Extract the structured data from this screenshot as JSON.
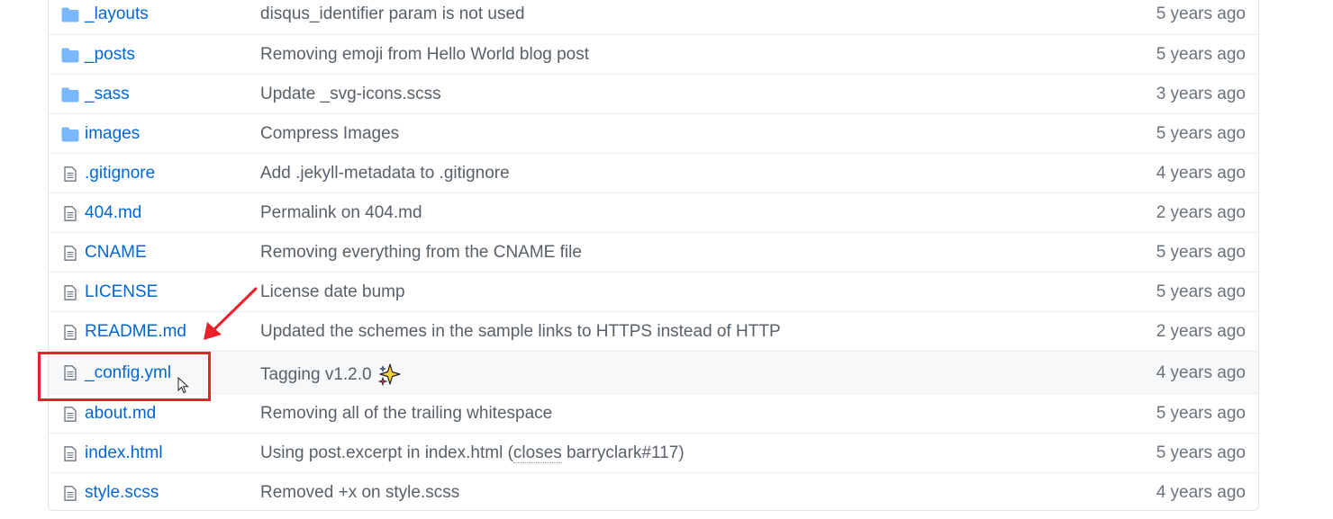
{
  "accent": "#0366d6",
  "annotation_color": "#e8212b",
  "files": [
    {
      "type": "folder",
      "icon": "folder-icon",
      "name": "_layouts",
      "message": "disqus_identifier param is not used",
      "age": "5 years ago"
    },
    {
      "type": "folder",
      "icon": "folder-icon",
      "name": "_posts",
      "message": "Removing emoji from Hello World blog post",
      "age": "5 years ago"
    },
    {
      "type": "folder",
      "icon": "folder-icon",
      "name": "_sass",
      "message": "Update _svg-icons.scss",
      "age": "3 years ago"
    },
    {
      "type": "folder",
      "icon": "folder-icon",
      "name": "images",
      "message": "Compress Images",
      "age": "5 years ago"
    },
    {
      "type": "file",
      "icon": "file-icon",
      "name": ".gitignore",
      "message": "Add .jekyll-metadata to .gitignore",
      "age": "4 years ago"
    },
    {
      "type": "file",
      "icon": "file-icon",
      "name": "404.md",
      "message": "Permalink on 404.md",
      "age": "2 years ago"
    },
    {
      "type": "file",
      "icon": "file-icon",
      "name": "CNAME",
      "message": "Removing everything from the CNAME file",
      "age": "5 years ago"
    },
    {
      "type": "file",
      "icon": "file-icon",
      "name": "LICENSE",
      "message": "License date bump",
      "age": "5 years ago"
    },
    {
      "type": "file",
      "icon": "file-icon",
      "name": "README.md",
      "message": "Updated the schemes in the sample links to HTTPS instead of HTTP",
      "age": "2 years ago"
    },
    {
      "type": "file",
      "icon": "file-icon",
      "name": "_config.yml",
      "message": "Tagging v1.2.0",
      "emoji": "sparkles-icon",
      "age": "4 years ago",
      "highlighted": true
    },
    {
      "type": "file",
      "icon": "file-icon",
      "name": "about.md",
      "message": "Removing all of the trailing whitespace",
      "age": "5 years ago"
    },
    {
      "type": "file",
      "icon": "file-icon",
      "name": "index.html",
      "message_parts": [
        "Using post.excerpt in index.html (",
        "closes",
        " ",
        "barryclark#117",
        ")"
      ],
      "age": "5 years ago"
    },
    {
      "type": "file",
      "icon": "file-icon",
      "name": "style.scss",
      "message": "Removed +x on style.scss",
      "age": "4 years ago"
    }
  ]
}
